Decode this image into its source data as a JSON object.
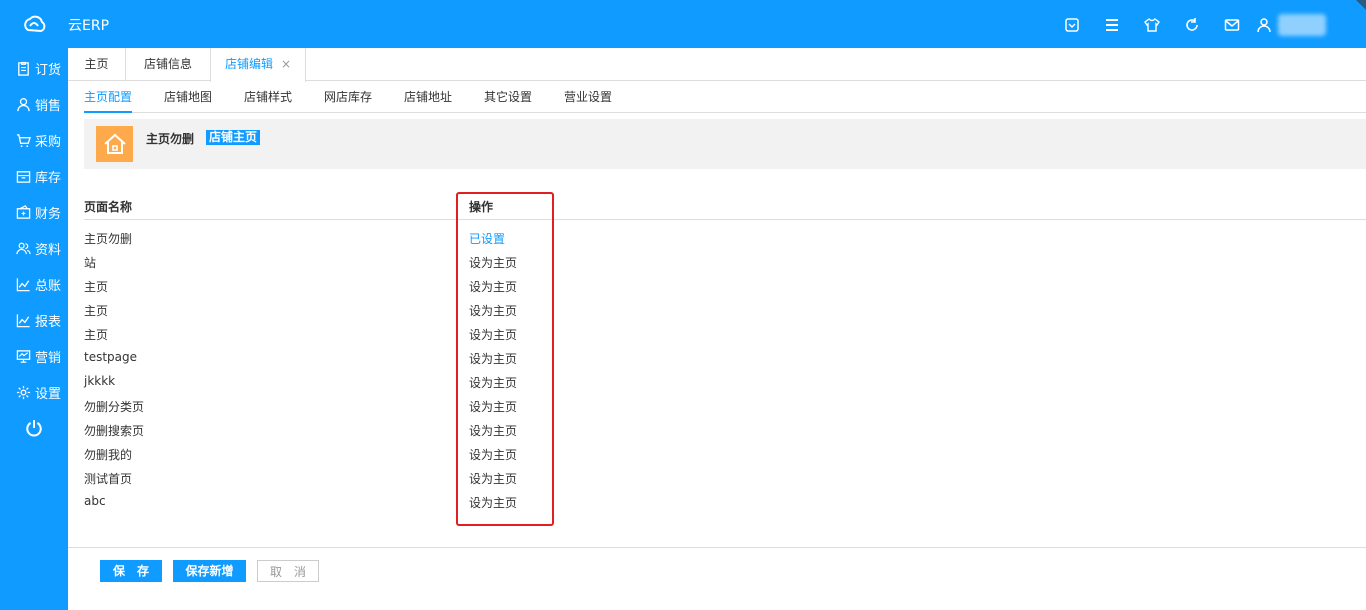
{
  "app": {
    "title": "云ERP"
  },
  "colors": {
    "primary": "#0f9bff",
    "highlight": "#e02020",
    "house_bg": "#ffa94d"
  },
  "topbar_icons": [
    "dropdown-box-icon",
    "menu-icon",
    "shirt-icon",
    "refresh-icon",
    "mail-icon",
    "user-icon"
  ],
  "sidebar": {
    "items": [
      {
        "label": "订货",
        "icon": "clipboard-icon"
      },
      {
        "label": "销售",
        "icon": "person-icon"
      },
      {
        "label": "采购",
        "icon": "cart-icon"
      },
      {
        "label": "库存",
        "icon": "box-icon"
      },
      {
        "label": "财务",
        "icon": "wallet-icon"
      },
      {
        "label": "资料",
        "icon": "people-icon"
      },
      {
        "label": "总账",
        "icon": "chart-icon"
      },
      {
        "label": "报表",
        "icon": "chart-icon"
      },
      {
        "label": "营销",
        "icon": "monitor-icon"
      },
      {
        "label": "设置",
        "icon": "gear-icon"
      }
    ],
    "power_icon": "power-icon"
  },
  "tabs": [
    {
      "label": "主页"
    },
    {
      "label": "店铺信息"
    },
    {
      "label": "店铺编辑",
      "close": "×"
    }
  ],
  "subtabs": [
    "主页配置",
    "店铺地图",
    "店铺样式",
    "网店库存",
    "店铺地址",
    "其它设置",
    "营业设置"
  ],
  "info": {
    "name": "主页勿删",
    "badge": "店铺主页"
  },
  "table": {
    "headers": {
      "name": "页面名称",
      "op": "操作"
    },
    "rows": [
      {
        "name": "主页勿删",
        "op": "已设置"
      },
      {
        "name": "站",
        "op": "设为主页"
      },
      {
        "name": "主页",
        "op": "设为主页"
      },
      {
        "name": "主页",
        "op": "设为主页"
      },
      {
        "name": "主页",
        "op": "设为主页"
      },
      {
        "name": "testpage",
        "op": "设为主页"
      },
      {
        "name": "jkkkk",
        "op": "设为主页"
      },
      {
        "name": "勿删分类页",
        "op": "设为主页"
      },
      {
        "name": "勿删搜索页",
        "op": "设为主页"
      },
      {
        "name": "勿删我的",
        "op": "设为主页"
      },
      {
        "name": "测试首页",
        "op": "设为主页"
      },
      {
        "name": "abc",
        "op": "设为主页"
      }
    ]
  },
  "footer": {
    "save": "保　存",
    "save_new": "保存新增",
    "cancel": "取　消"
  }
}
